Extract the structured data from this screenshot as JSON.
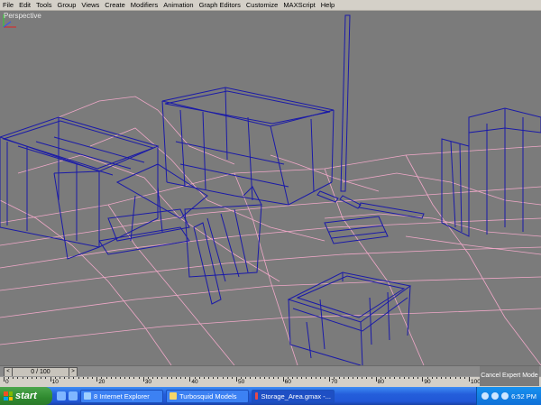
{
  "menu": {
    "items": [
      "File",
      "Edit",
      "Tools",
      "Group",
      "Views",
      "Create",
      "Modifiers",
      "Animation",
      "Graph Editors",
      "Customize",
      "MAXScript",
      "Help"
    ]
  },
  "viewport": {
    "label": "Perspective",
    "background": "#7b7b7b",
    "wire_blue": "#1a1aa8",
    "wire_pink": "#f0a8c8"
  },
  "timeline": {
    "slider_label": "0 / 100",
    "prev_glyph": "<",
    "next_glyph": ">",
    "ticks": [
      "0",
      "10",
      "20",
      "30",
      "40",
      "50",
      "60",
      "70",
      "80",
      "90",
      "100"
    ]
  },
  "expert_mode": {
    "label": "Cancel Expert Mode"
  },
  "taskbar": {
    "start_label": "start",
    "tasks": [
      {
        "label": "8 Internet Explorer",
        "icon": "internet-explorer-icon"
      },
      {
        "label": "Turbosquid Models",
        "icon": "folder-icon"
      },
      {
        "label": "Storage_Area.gmax -...",
        "icon": "gmax-icon"
      }
    ],
    "clock": "6:52 PM"
  }
}
